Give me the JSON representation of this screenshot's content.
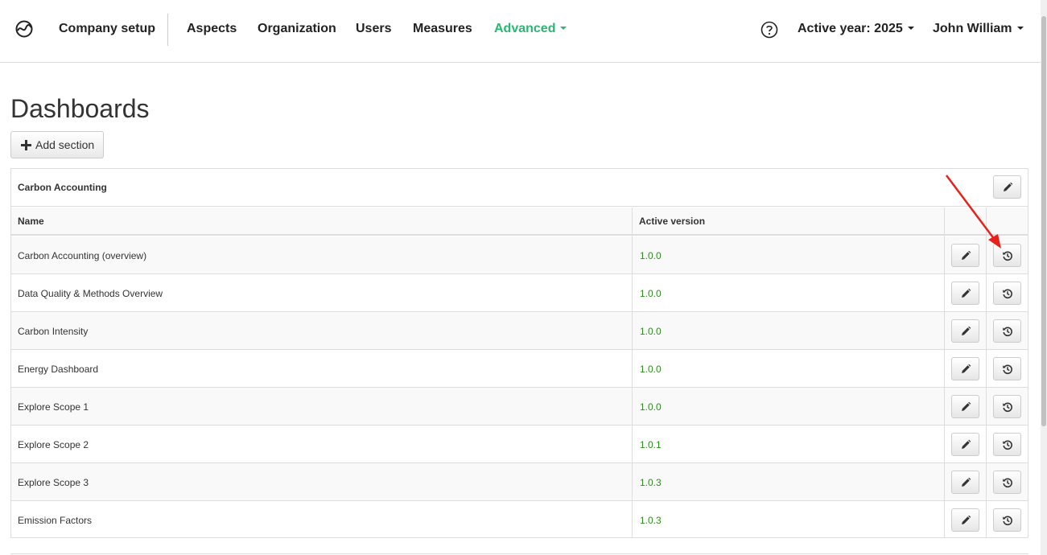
{
  "nav": {
    "company_setup": "Company setup",
    "aspects": "Aspects",
    "organization": "Organization",
    "users": "Users",
    "measures": "Measures",
    "advanced": "Advanced",
    "active_year": "Active year: 2025",
    "user": "John William"
  },
  "page": {
    "title": "Dashboards",
    "add_section": "Add section"
  },
  "section": {
    "title": "Carbon Accounting",
    "columns": {
      "name": "Name",
      "active_version": "Active version"
    },
    "rows": [
      {
        "name": "Carbon Accounting (overview)",
        "version": "1.0.0"
      },
      {
        "name": "Data Quality & Methods Overview",
        "version": "1.0.0"
      },
      {
        "name": "Carbon Intensity",
        "version": "1.0.0"
      },
      {
        "name": "Energy Dashboard",
        "version": "1.0.0"
      },
      {
        "name": "Explore Scope 1",
        "version": "1.0.0"
      },
      {
        "name": "Explore Scope 2",
        "version": "1.0.1"
      },
      {
        "name": "Explore Scope 3",
        "version": "1.0.3"
      },
      {
        "name": "Emission Factors",
        "version": "1.0.3"
      }
    ]
  },
  "colors": {
    "accent": "#2bb673",
    "version": "#2e8b1e",
    "annotation_arrow": "#e8221b"
  },
  "icons": [
    "logo-icon",
    "help-icon",
    "plus-icon",
    "pencil-icon",
    "history-icon",
    "caret-down-icon"
  ]
}
